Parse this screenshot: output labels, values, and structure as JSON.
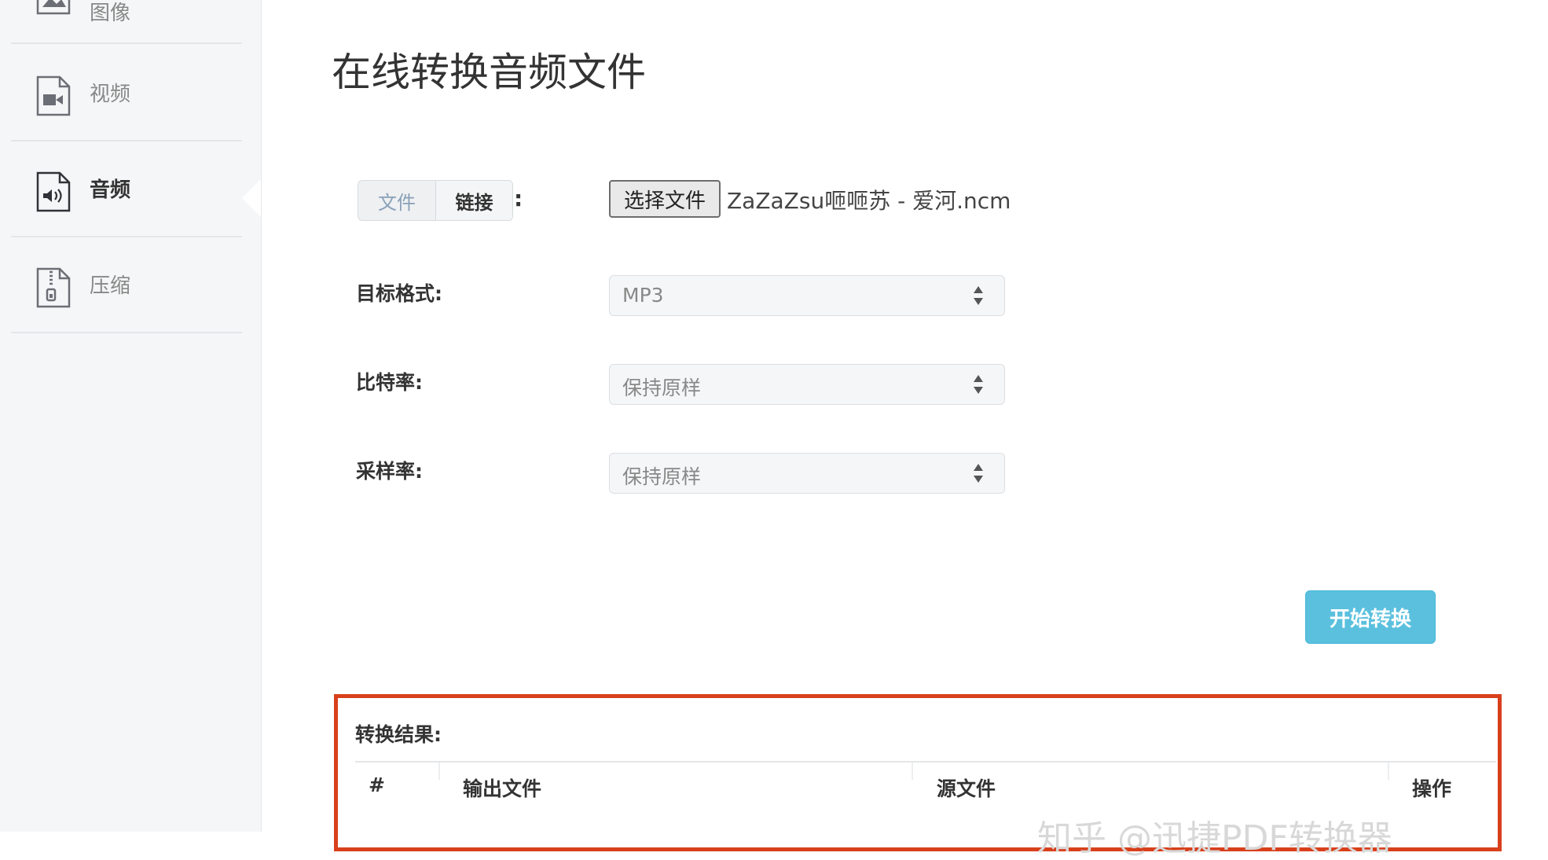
{
  "sidebar": {
    "items": [
      {
        "label": "图像",
        "icon": "image-file-icon"
      },
      {
        "label": "视频",
        "icon": "video-file-icon"
      },
      {
        "label": "音频",
        "icon": "audio-file-icon",
        "active": true
      },
      {
        "label": "压缩",
        "icon": "zip-file-icon"
      }
    ]
  },
  "main": {
    "title": "在线转换音频文件",
    "source_tabs": [
      "文件",
      "链接"
    ],
    "source_colon": ":",
    "choose_file_label": "选择文件",
    "selected_file": "ZaZaZsu咂咂苏 - 爱河.ncm",
    "fields": [
      {
        "label": "目标格式:",
        "value": "MP3"
      },
      {
        "label": "比特率:",
        "value": "保持原样"
      },
      {
        "label": "采样率:",
        "value": "保持原样"
      }
    ],
    "start_button": "开始转换"
  },
  "results": {
    "title": "转换结果:",
    "columns": [
      "#",
      "输出文件",
      "源文件",
      "操作"
    ]
  },
  "watermark": "知乎 @迅捷PDF转换器",
  "colors": {
    "accent": "#5bc0de",
    "highlight_box": "#d8401c",
    "sidebar_bg": "#f5f6f7"
  }
}
